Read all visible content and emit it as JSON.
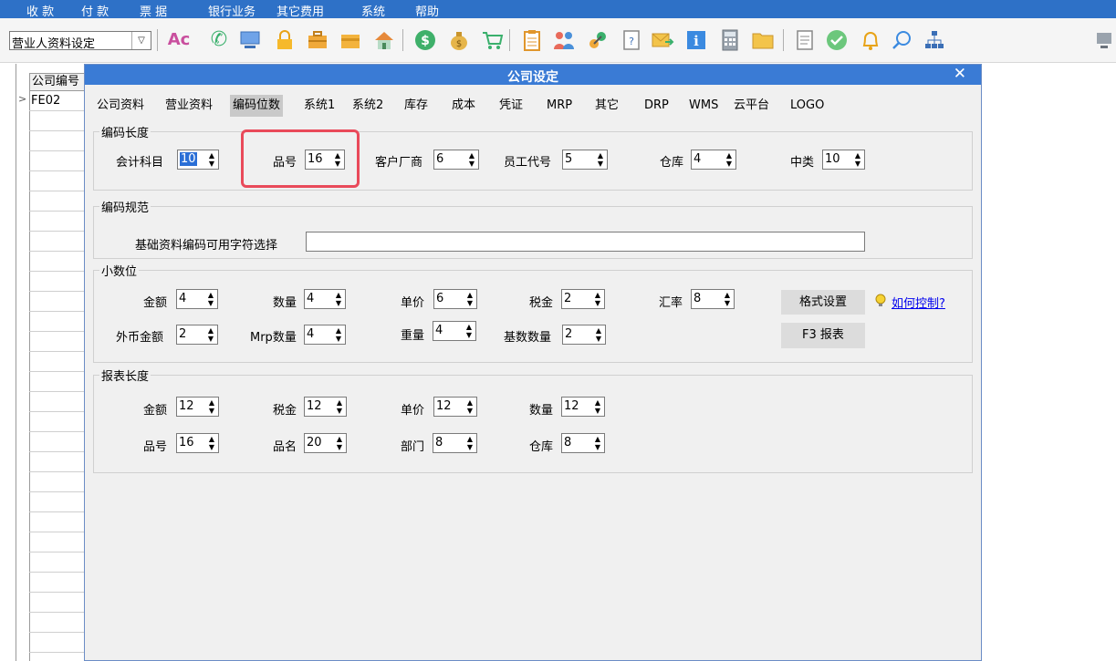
{
  "menu": [
    "收 款",
    "付 款",
    "票 据",
    "银行业务",
    "其它费用",
    "系统",
    "帮助"
  ],
  "toolbar": {
    "combo_value": "营业人资料设定",
    "icons": [
      "spellcheck-icon",
      "phone-icon",
      "monitor-icon",
      "lock-icon",
      "briefcase-icon",
      "folder-icon",
      "home-icon",
      "dollar-icon",
      "money-bag-icon",
      "cart-icon",
      "clipboard-icon",
      "users-icon",
      "link-icon",
      "help-document-icon",
      "mail-forward-icon",
      "info-icon",
      "calculator-icon",
      "folder-closed-icon",
      "document-icon",
      "check-circle-icon",
      "bell-icon",
      "search-icon",
      "org-chart-icon",
      "screen-icon"
    ]
  },
  "grid": {
    "header": "公司编号",
    "rows": [
      "FE02"
    ]
  },
  "dialog": {
    "title": "公司设定",
    "close": "✕",
    "tabs": [
      "公司资料",
      "营业资料",
      "编码位数",
      "系统1",
      "系统2",
      "库存",
      "成本",
      "凭证",
      "MRP",
      "其它",
      "DRP",
      "WMS",
      "云平台",
      "LOGO"
    ],
    "active_tab": "编码位数",
    "code_length": {
      "title": "编码长度",
      "fields": [
        {
          "label": "会计科目",
          "value": "10"
        },
        {
          "label": "品号",
          "value": "16"
        },
        {
          "label": "客户厂商",
          "value": "6"
        },
        {
          "label": "员工代号",
          "value": "5"
        },
        {
          "label": "仓库",
          "value": "4"
        },
        {
          "label": "中类",
          "value": "10"
        }
      ]
    },
    "code_rule": {
      "title": "编码规范",
      "label": "基础资料编码可用字符选择",
      "value": ""
    },
    "decimals": {
      "title": "小数位",
      "fields": [
        {
          "label": "金额",
          "value": "4"
        },
        {
          "label": "数量",
          "value": "4"
        },
        {
          "label": "单价",
          "value": "6"
        },
        {
          "label": "税金",
          "value": "2"
        },
        {
          "label": "汇率",
          "value": "8"
        },
        {
          "label": "外币金额",
          "value": "2"
        },
        {
          "label": "Mrp数量",
          "value": "4"
        },
        {
          "label": "重量",
          "value": "4"
        },
        {
          "label": "基数数量",
          "value": "2"
        }
      ],
      "format_button": "格式设置",
      "report_button": "F3 报表",
      "help_link": "如何控制?"
    },
    "report_length": {
      "title": "报表长度",
      "fields": [
        {
          "label": "金额",
          "value": "12"
        },
        {
          "label": "税金",
          "value": "12"
        },
        {
          "label": "单价",
          "value": "12"
        },
        {
          "label": "数量",
          "value": "12"
        },
        {
          "label": "品号",
          "value": "16"
        },
        {
          "label": "品名",
          "value": "20"
        },
        {
          "label": "部门",
          "value": "8"
        },
        {
          "label": "仓库",
          "value": "8"
        }
      ]
    }
  },
  "colors": {
    "menubar": "#2e71c7",
    "dialog_title": "#3a7bd5",
    "highlight": "#e94a5a",
    "active_tab": "#c9c9c9"
  }
}
